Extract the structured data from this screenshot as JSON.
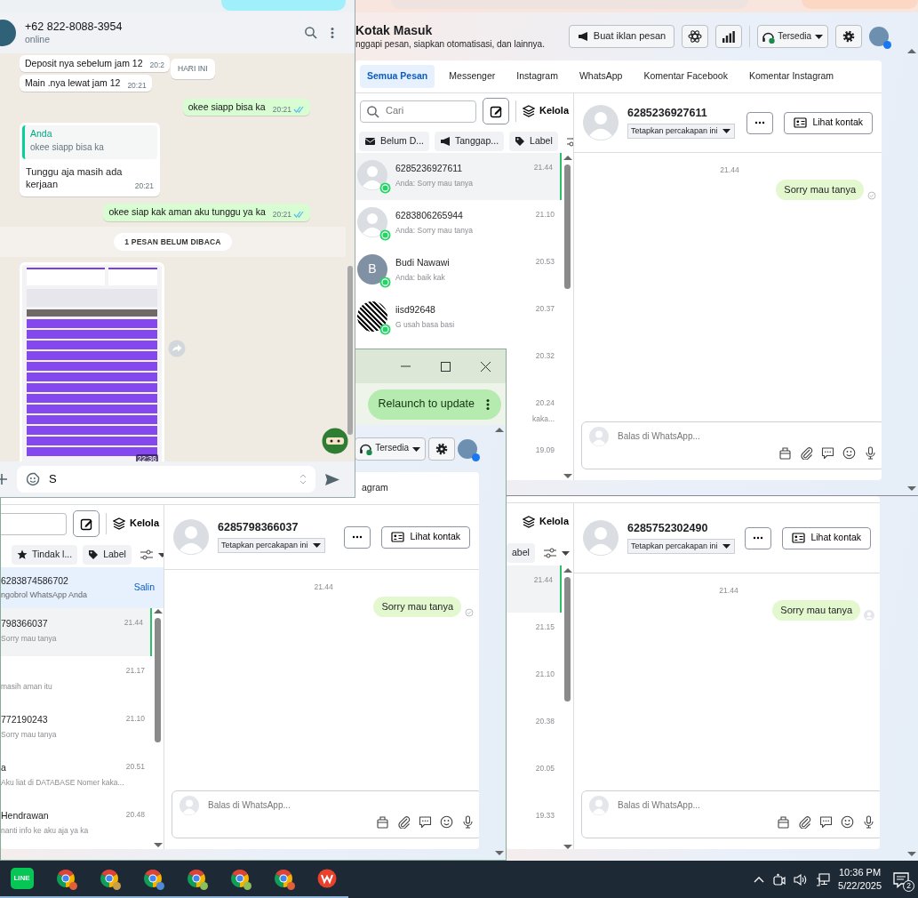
{
  "whatsapp_window": {
    "contact": {
      "name": "+62 822-8088-3954",
      "status": "online"
    },
    "date_chip": "HARI INI",
    "messages": [
      {
        "kind": "in",
        "text": "Deposit nya sebelum jam 12",
        "time": "20:2"
      },
      {
        "kind": "in",
        "text": "Main .nya lewat jam 12",
        "time": "20:21"
      },
      {
        "kind": "out",
        "text": "okee siapp bisa ka",
        "time": "20:21",
        "read": true
      },
      {
        "kind": "reply",
        "quote_author": "Anda",
        "quote": "okee siapp bisa ka",
        "text": "Tunggu aja masih ada kerjaan",
        "time": "20:21"
      },
      {
        "kind": "out",
        "text": "okee siap kak aman aku tunggu ya ka",
        "time": "20:21",
        "read": true
      },
      {
        "kind": "unread",
        "text": "1 PESAN BELUM DIBACA"
      },
      {
        "kind": "image",
        "time": "22:36"
      }
    ],
    "composer": {
      "value": "S"
    }
  },
  "inbox_top": {
    "title": "Kotak Masuk",
    "subtitle": "nggapi pesan, siapkan otomatisasi, dan lainnya.",
    "ad_button": "Buat iklan pesan",
    "status": "Tersedia",
    "tabs": [
      {
        "label": "Semua Pesan",
        "selected": true
      },
      {
        "label": "Messenger",
        "selected": false
      },
      {
        "label": "Instagram",
        "selected": false
      },
      {
        "label": "WhatsApp",
        "selected": false
      },
      {
        "label": "Komentar Facebook",
        "selected": false
      },
      {
        "label": "Komentar Instagram",
        "selected": false
      }
    ],
    "search": {
      "placeholder": "Cari"
    },
    "manage": "Kelola",
    "filters": [
      {
        "kind": "envelope",
        "label": "Belum D..."
      },
      {
        "kind": "megaphone",
        "label": "Tanggap..."
      },
      {
        "kind": "tag",
        "label": "Label"
      }
    ],
    "conversations": [
      {
        "kind": "full",
        "avatar": {
          "kind": "silhouette"
        },
        "name": "6285236927611",
        "preview": "Anda: Sorry mau tanya",
        "time": "21.44",
        "selected": true
      },
      {
        "kind": "full",
        "avatar": {
          "kind": "silhouette"
        },
        "name": "6283806265944",
        "preview": "Anda: Sorry mau tanya",
        "time": "21.10",
        "selected": false
      },
      {
        "kind": "full",
        "avatar": {
          "kind": "letter",
          "letter": "B"
        },
        "name": "Budi Nawawi",
        "preview": "Anda: baik kak",
        "time": "20.53",
        "selected": false
      },
      {
        "kind": "full",
        "avatar": {
          "kind": "photo"
        },
        "name": "iisd92648",
        "preview": "G usah basa basi",
        "time": "20.37",
        "selected": false
      },
      {
        "kind": "partial",
        "time": "20.32",
        "selected": false
      },
      {
        "kind": "partial",
        "preview": "kaka...",
        "time": "20.24",
        "selected": false
      },
      {
        "kind": "partial",
        "time": "19.09",
        "selected": false
      }
    ],
    "thread": {
      "name": "6285236927611",
      "assign": "Tetapkan percakapan ini",
      "contact_button": "Lihat kontak",
      "time": "21.44",
      "messages": [
        {
          "text": "Sorry mau tanya",
          "seen": false
        }
      ],
      "reply_placeholder": "Balas di WhatsApp..."
    }
  },
  "inbox_bottom_left": {
    "update_button": "Relaunch to update",
    "status": "Tersedia",
    "tabs": [
      {
        "label": "agram",
        "selected": false
      }
    ],
    "manage": "Kelola",
    "filters": [
      {
        "kind": "star",
        "label": "Tindak l..."
      },
      {
        "kind": "tag",
        "label": "Label"
      }
    ],
    "banner": {
      "number": "6283874586702",
      "text": "ngobrol WhatsApp Anda",
      "action": "Salin"
    },
    "conversations": [
      {
        "name": "798366037",
        "preview": "Sorry mau tanya",
        "time": "21.44",
        "selected": true
      },
      {
        "preview": "masih aman itu",
        "time": "21.17",
        "selected": false
      },
      {
        "name": "772190243",
        "preview": "Sorry mau tanya",
        "time": "21.10",
        "selected": false
      },
      {
        "name": "a",
        "preview": "Aku liat di DATABASE Nomer kaka...",
        "time": "20.51",
        "selected": false
      },
      {
        "name": "Hendrawan",
        "preview": "nanti info ke aku aja ya ka",
        "time": "20.48",
        "selected": false
      }
    ],
    "thread": {
      "name": "6285798366037",
      "assign": "Tetapkan percakapan ini",
      "contact_button": "Lihat kontak",
      "time": "21.44",
      "messages": [
        {
          "text": "Sorry mau tanya",
          "seen": false
        }
      ],
      "reply_placeholder": "Balas di WhatsApp..."
    }
  },
  "inbox_bottom_right": {
    "manage": "Kelola",
    "filters": [
      {
        "label": "abel"
      }
    ],
    "conversations": [
      {
        "time": "21.44",
        "selected": true
      },
      {
        "time": "21.15",
        "selected": false
      },
      {
        "time": "21.10",
        "selected": false
      },
      {
        "time": "20.38",
        "selected": false
      },
      {
        "time": "20.05",
        "selected": false
      },
      {
        "time": "19.33",
        "selected": false
      }
    ],
    "thread": {
      "name": "6285752302490",
      "assign": "Tetapkan percakapan ini",
      "contact_button": "Lihat kontak",
      "time": "21.44",
      "messages": [
        {
          "text": "Sorry mau tanya",
          "seen": true
        }
      ],
      "reply_placeholder": "Balas di WhatsApp..."
    }
  },
  "taskbar": {
    "apps": [
      {
        "kind": "line",
        "label": "LINE",
        "running": true
      },
      {
        "kind": "chrome",
        "color": "#e0603a",
        "running": true
      },
      {
        "kind": "chrome",
        "color": "#c9a04a",
        "running": true
      },
      {
        "kind": "chrome",
        "color": "#4f8ad6",
        "running": true
      },
      {
        "kind": "chrome",
        "color": "#8bbf5a",
        "running": true
      },
      {
        "kind": "chrome",
        "color": "#8bbf5a",
        "running": true
      },
      {
        "kind": "chrome",
        "color": "#e0603a",
        "running": true
      },
      {
        "kind": "office",
        "running": true
      }
    ],
    "time": "10:36 PM",
    "date": "5/22/2025",
    "notifications": "2"
  }
}
